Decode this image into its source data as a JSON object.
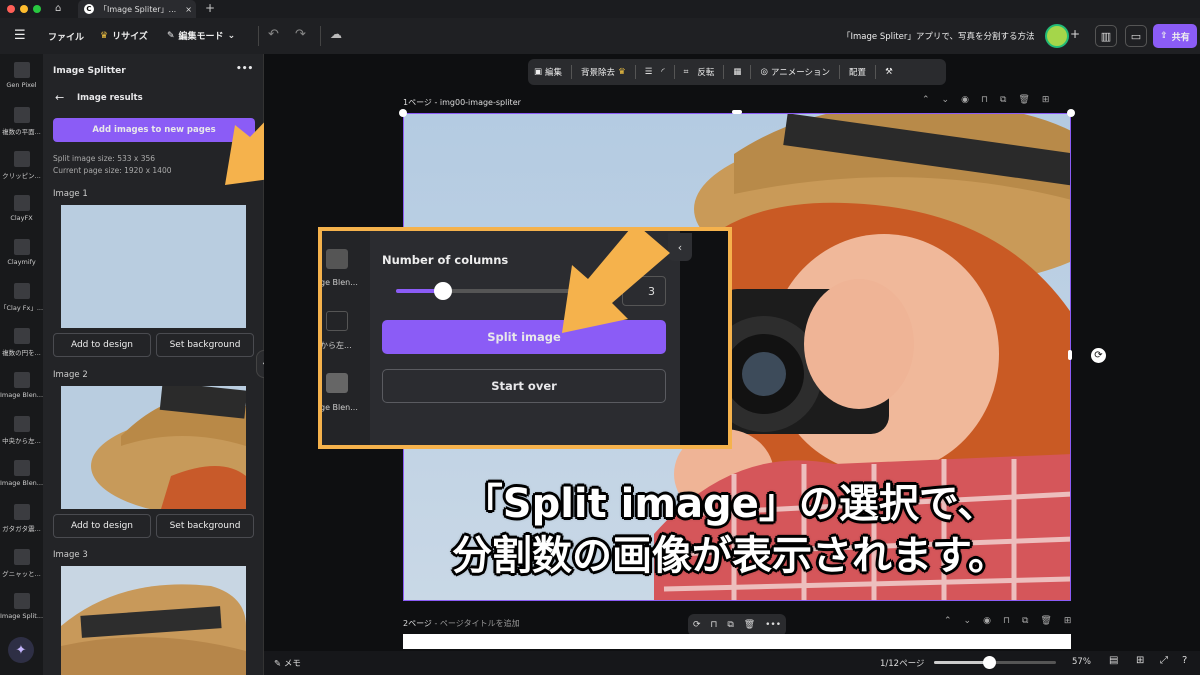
{
  "tab": {
    "title": "「Image Spliter」..."
  },
  "toolbar": {
    "file": "ファイル",
    "resize": "リサイズ",
    "edit_mode": "編集モード",
    "doc_title": "「Image Spliter」アプリで、写真を分割する方法",
    "share": "共有"
  },
  "rail": [
    {
      "label": "Gen Pixel"
    },
    {
      "label": "複数の平面..."
    },
    {
      "label": "クリッピン..."
    },
    {
      "label": "ClayFX"
    },
    {
      "label": "Claymify"
    },
    {
      "label": "「Clay Fx」..."
    },
    {
      "label": "複数の円を..."
    },
    {
      "label": "Image Blen..."
    },
    {
      "label": "中央から左..."
    },
    {
      "label": "Image Blen..."
    },
    {
      "label": "ガタガタ震..."
    },
    {
      "label": "グニャッと..."
    },
    {
      "label": "Image Split..."
    }
  ],
  "panel": {
    "title": "Image Splitter",
    "more": "•••",
    "back_label": "Image results",
    "add_button": "Add images to new pages",
    "split_size": "Split image size: 533 x 356",
    "page_size": "Current page size: 1920 x 1400",
    "images": [
      {
        "label": "Image 1",
        "add": "Add to design",
        "bg": "Set background"
      },
      {
        "label": "Image 2",
        "add": "Add to design",
        "bg": "Set background"
      },
      {
        "label": "Image 3"
      }
    ]
  },
  "context_toolbar": {
    "edit": "編集",
    "bg_remove": "背景除去",
    "flip": "反転",
    "animation": "アニメーション",
    "arrange": "配置"
  },
  "page1": {
    "label": "1ページ - img00-image-spliter"
  },
  "page2": {
    "label": "2ページ",
    "placeholder": " - ページタイトルを追加"
  },
  "dialog": {
    "columns_label": "Number of columns",
    "column_value": "3",
    "split_button": "Split image",
    "start_over": "Start over",
    "side_items": [
      "ge Blen...",
      "から左...",
      "ge Blen..."
    ],
    "slider_fraction": 0.26
  },
  "caption": {
    "line1": "「Split image」の選択で、",
    "line2": "分割数の画像が表示されます。"
  },
  "bottom": {
    "memo": "メモ",
    "pages": "1/12ページ",
    "zoom": "57%",
    "zoom_fraction": 0.45
  },
  "colors": {
    "accent": "#8b5cf6",
    "arrow": "#f5b24c"
  }
}
